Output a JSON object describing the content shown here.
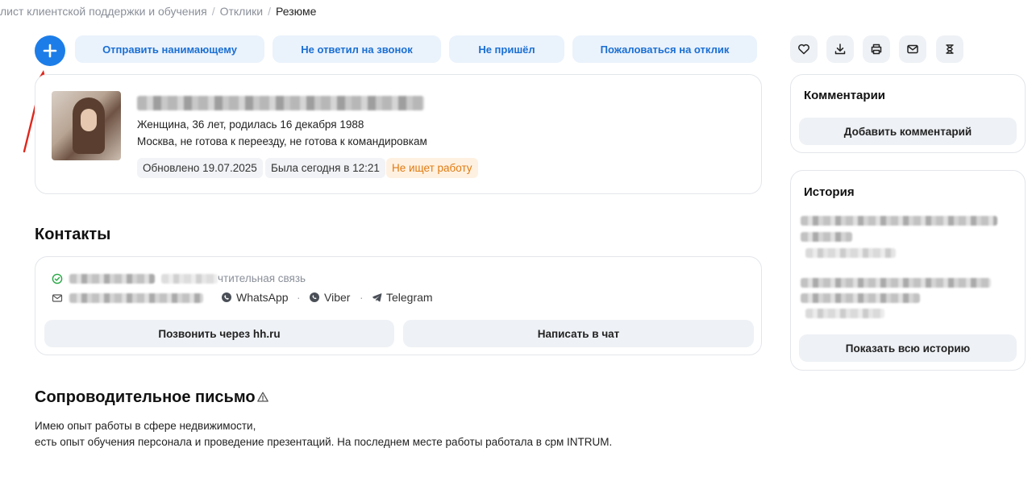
{
  "breadcrumb": {
    "items": [
      "лист клиентской поддержки и обучения",
      "Отклики",
      "Резюме"
    ],
    "separator": "/"
  },
  "toolbar": {
    "add_icon": "plus-icon",
    "actions": [
      "Отправить нанимающему",
      "Не ответил на звонок",
      "Не пришёл",
      "Пожаловаться на отклик"
    ],
    "icons": [
      "heart-icon",
      "download-icon",
      "print-icon",
      "mail-icon",
      "share-icon"
    ]
  },
  "profile": {
    "gender_age_birth": "Женщина, 36 лет, родилась 16 декабря 1988",
    "location": "Москва, не готова к переезду, не готова к командировкам",
    "tags": {
      "updated": "Обновлено 19.07.2025",
      "last_seen": "Была сегодня в 12:21",
      "status": "Не ищет работу"
    }
  },
  "contacts": {
    "title": "Контакты",
    "phone_note": "чтительная связь",
    "messengers": [
      "WhatsApp",
      "Viber",
      "Telegram"
    ],
    "call_button": "Позвонить через hh.ru",
    "chat_button": "Написать в чат"
  },
  "cover_letter": {
    "title": "Сопроводительное письмо",
    "lines": [
      "Имею опыт работы в сфере недвижимости,",
      "есть опыт обучения персонала и проведение презентаций. На последнем месте работы работала в срм INTRUM."
    ]
  },
  "comments": {
    "title": "Комментарии",
    "add_button": "Добавить комментарий"
  },
  "history": {
    "title": "История",
    "show_all_button": "Показать всю историю"
  },
  "colors": {
    "accent": "#1d7de8",
    "accent_text": "#1a6fd3",
    "status_orange": "#e07b12",
    "annotation_arrow": "#e0261b"
  }
}
